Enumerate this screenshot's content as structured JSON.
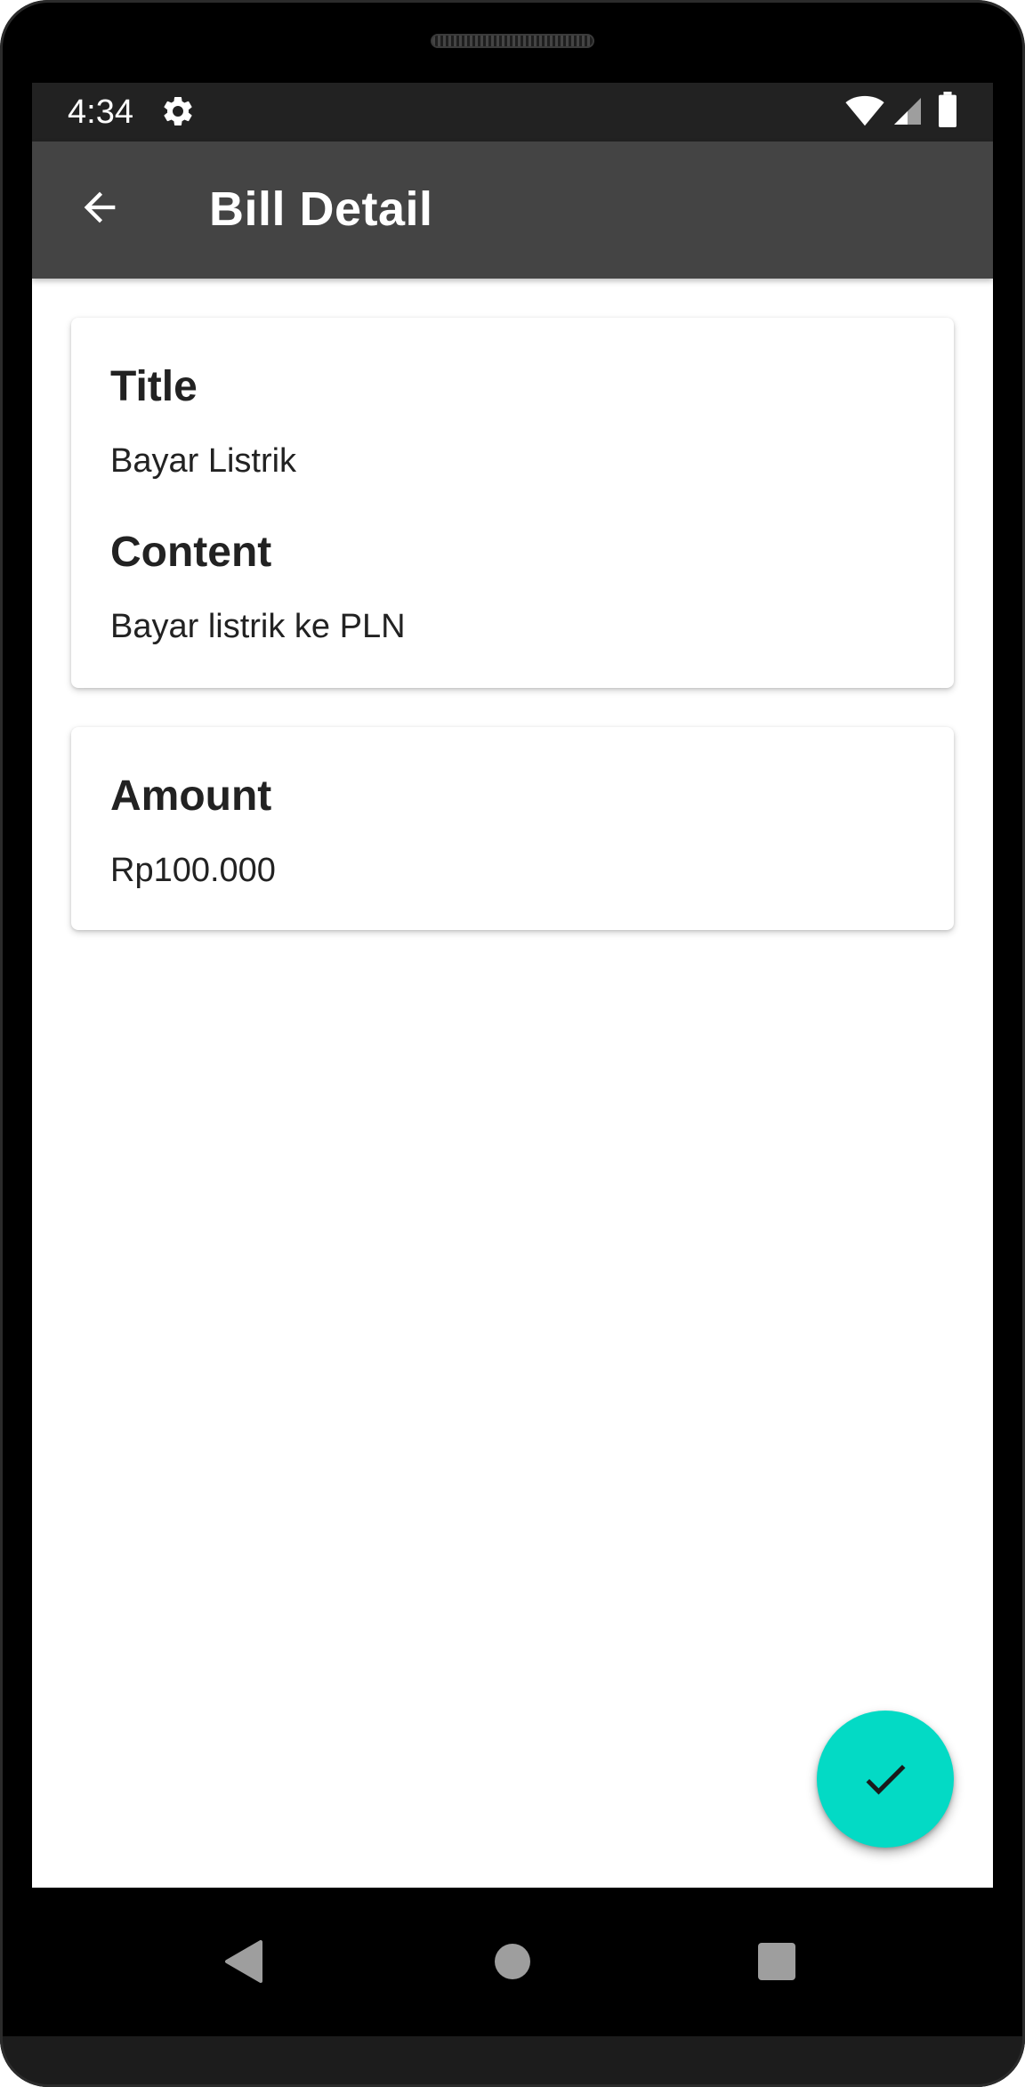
{
  "status_bar": {
    "time": "4:34",
    "icons": [
      "gear-icon",
      "wifi-icon",
      "signal-icon",
      "battery-icon"
    ]
  },
  "app_bar": {
    "title": "Bill Detail",
    "back_icon": "arrow-left-icon"
  },
  "details_card": {
    "title_label": "Title",
    "title_value": "Bayar Listrik",
    "content_label": "Content",
    "content_value": "Bayar listrik ke PLN"
  },
  "amount_card": {
    "amount_label": "Amount",
    "amount_value": "Rp100.000"
  },
  "fab": {
    "icon": "check-icon"
  },
  "nav_bar": {
    "icons": [
      "nav-back-icon",
      "nav-home-icon",
      "nav-recents-icon"
    ]
  },
  "colors": {
    "status_bar": "#222222",
    "app_bar": "#444444",
    "fab": "#03DAC5",
    "text": "#222222"
  }
}
